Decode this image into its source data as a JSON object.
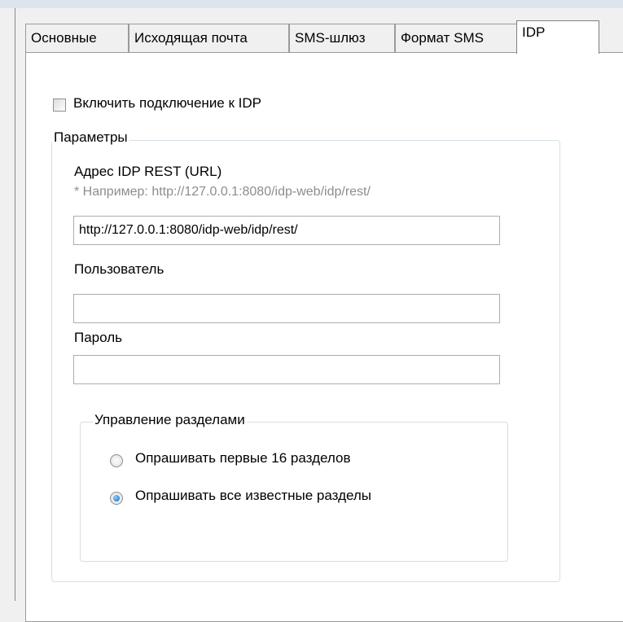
{
  "tabs": [
    "Основные",
    "Исходящая почта",
    "SMS-шлюз",
    "Формат SMS",
    "IDP"
  ],
  "enable_idp": {
    "label": "Включить подключение к IDP",
    "checked": false
  },
  "params": {
    "legend": "Параметры",
    "url_label": "Адрес IDP REST (URL)",
    "url_hint": "* Например: http://127.0.0.1:8080/idp-web/idp/rest/",
    "url_value": "http://127.0.0.1:8080/idp-web/idp/rest/",
    "user_label": "Пользователь",
    "user_value": "",
    "password_label": "Пароль",
    "password_value": ""
  },
  "sections": {
    "legend": "Управление разделами",
    "option_first16": "Опрашивать первые 16 разделов",
    "option_all": "Опрашивать все известные разделы",
    "selected": "option_all"
  }
}
